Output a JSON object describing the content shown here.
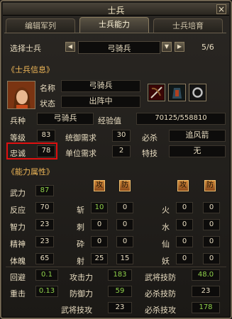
{
  "window": {
    "title": "士兵",
    "close": "×"
  },
  "tabs": [
    {
      "label": "编辑军列",
      "active": false
    },
    {
      "label": "士兵能力",
      "active": true
    },
    {
      "label": "士兵培育",
      "active": false
    }
  ],
  "selector": {
    "label": "选择士兵",
    "value": "弓骑兵",
    "page": "5/6"
  },
  "info": {
    "section": "《士兵信息》",
    "name_label": "名称",
    "name_value": "弓骑兵",
    "status_label": "状态",
    "status_value": "出阵中",
    "type_label": "兵种",
    "type_value": "弓骑兵",
    "exp_label": "经验值",
    "exp_value": "70125/558810",
    "level_label": "等级",
    "level_value": "83",
    "command_label": "统御需求",
    "command_value": "30",
    "kill_label": "必杀",
    "kill_value": "追风箭",
    "loyalty_label": "忠诚",
    "loyalty_value": "78",
    "unit_label": "单位需求",
    "unit_value": "2",
    "skill_label": "特技",
    "skill_value": "无"
  },
  "attributes": {
    "section": "《能力属性》",
    "attack_badge": "攻",
    "defense_badge": "防",
    "left": [
      {
        "label": "武力",
        "value": "87",
        "green": true
      },
      {
        "label": "反应",
        "value": "70"
      },
      {
        "label": "智力",
        "value": "23"
      },
      {
        "label": "精神",
        "value": "23"
      },
      {
        "label": "体魄",
        "value": "65"
      }
    ],
    "mid": [
      {
        "label": "斩",
        "a": "10",
        "b": "0",
        "agreen": true
      },
      {
        "label": "刺",
        "a": "0",
        "b": "0"
      },
      {
        "label": "砕",
        "a": "0",
        "b": "0"
      },
      {
        "label": "射",
        "a": "25",
        "b": "15"
      }
    ],
    "right": [
      {
        "label": "火",
        "a": "0",
        "b": "0"
      },
      {
        "label": "水",
        "a": "0",
        "b": "0"
      },
      {
        "label": "仙",
        "a": "0",
        "b": "0"
      },
      {
        "label": "妖",
        "a": "0",
        "b": "0"
      }
    ]
  },
  "bottom": [
    {
      "l1": "回避",
      "v1": "0.1",
      "l2": "攻击力",
      "v2": "183",
      "l3": "武将技防",
      "v3": "48.0"
    },
    {
      "l1": "重击",
      "v1": "0.13",
      "l2": "防御力",
      "v2": "59",
      "l3": "必杀技防",
      "v3": "23"
    },
    {
      "l2": "武将技攻",
      "v2": "23",
      "l3": "必杀技攻",
      "v3": "178"
    }
  ]
}
